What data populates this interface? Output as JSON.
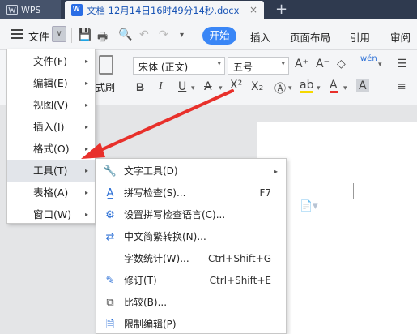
{
  "tabs": {
    "app": "WPS",
    "document": "文档 12月14日16时49分14秒.docx",
    "close": "×",
    "new": "+"
  },
  "menurow": {
    "file_label": "文件",
    "dropdown_glyph": "∨",
    "start_label": "开始",
    "ribbon_tabs": [
      "插入",
      "页面布局",
      "引用",
      "审阅"
    ]
  },
  "ribbon": {
    "format_brush": "式刷",
    "font_name": "宋体 (正文)",
    "font_size": "五号",
    "pinyin": "wén"
  },
  "main_menu": {
    "items": [
      {
        "label": "文件(F)",
        "active": false
      },
      {
        "label": "编辑(E)",
        "active": false
      },
      {
        "label": "视图(V)",
        "active": false
      },
      {
        "label": "插入(I)",
        "active": false
      },
      {
        "label": "格式(O)",
        "active": false
      },
      {
        "label": "工具(T)",
        "active": true
      },
      {
        "label": "表格(A)",
        "active": false
      },
      {
        "label": "窗口(W)",
        "active": false
      }
    ]
  },
  "tools_submenu": {
    "items": [
      {
        "label": "文字工具(D)",
        "shortcut": "",
        "icon": "wrench-icon",
        "has_submenu": true
      },
      {
        "label": "拼写检查(S)...",
        "shortcut": "F7",
        "icon": "spellcheck-icon",
        "has_submenu": false
      },
      {
        "label": "设置拼写检查语言(C)...",
        "shortcut": "",
        "icon": "language-icon",
        "has_submenu": false
      },
      {
        "label": "中文简繁转换(N)...",
        "shortcut": "",
        "icon": "convert-icon",
        "has_submenu": false
      },
      {
        "label": "字数统计(W)...",
        "shortcut": "Ctrl+Shift+G",
        "icon": "",
        "has_submenu": false
      },
      {
        "label": "修订(T)",
        "shortcut": "Ctrl+Shift+E",
        "icon": "revision-icon",
        "has_submenu": false
      },
      {
        "label": "比较(B)...",
        "shortcut": "",
        "icon": "compare-icon",
        "has_submenu": false
      },
      {
        "label": "限制编辑(P)",
        "shortcut": "",
        "icon": "restrict-icon",
        "has_submenu": false
      }
    ]
  },
  "colors": {
    "accent": "#3a86f6",
    "annotation_arrow": "#e8302b"
  }
}
